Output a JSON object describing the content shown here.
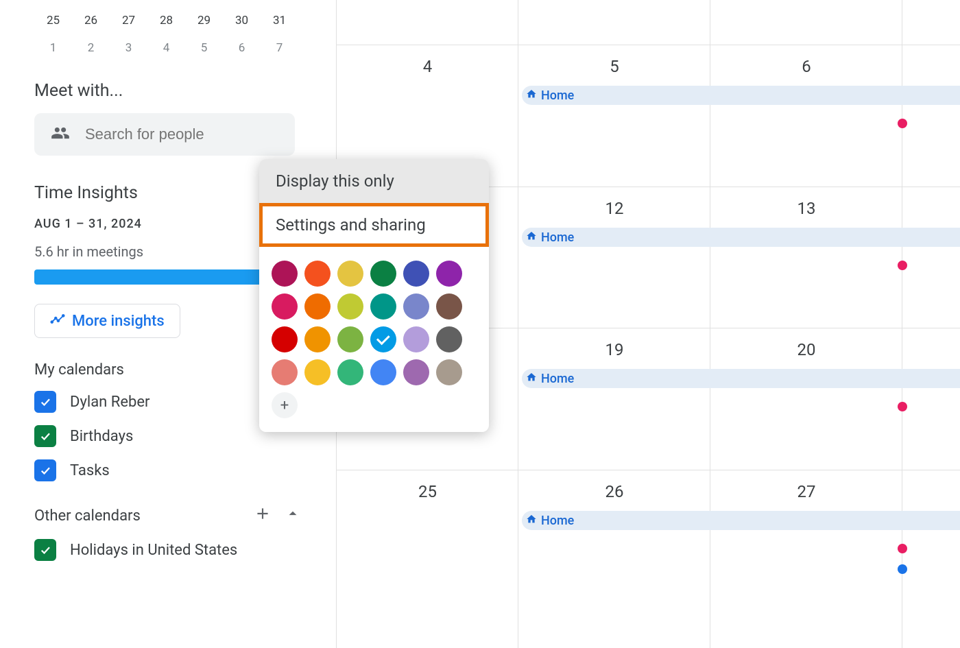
{
  "mini_calendar": {
    "rows": [
      [
        {
          "n": "25"
        },
        {
          "n": "26"
        },
        {
          "n": "27"
        },
        {
          "n": "28"
        },
        {
          "n": "29"
        },
        {
          "n": "30"
        },
        {
          "n": "31"
        }
      ],
      [
        {
          "n": "1",
          "dim": true
        },
        {
          "n": "2",
          "dim": true
        },
        {
          "n": "3",
          "dim": true
        },
        {
          "n": "4",
          "dim": true
        },
        {
          "n": "5",
          "dim": true
        },
        {
          "n": "6",
          "dim": true
        },
        {
          "n": "7",
          "dim": true
        }
      ]
    ]
  },
  "meet_with": {
    "title": "Meet with...",
    "placeholder": "Search for people"
  },
  "time_insights": {
    "title": "Time Insights",
    "range": "AUG 1 – 31, 2024",
    "meeting_hours": "5.6 hr in meetings",
    "more_label": "More insights"
  },
  "my_calendars": {
    "title": "My calendars",
    "items": [
      {
        "label": "Dylan Reber",
        "color": "blue"
      },
      {
        "label": "Birthdays",
        "color": "green"
      },
      {
        "label": "Tasks",
        "color": "blue"
      }
    ]
  },
  "other_calendars": {
    "title": "Other calendars",
    "items": [
      {
        "label": "Holidays in United States",
        "color": "green"
      }
    ]
  },
  "popup": {
    "option1": "Display this only",
    "option2": "Settings and sharing",
    "colors": [
      "#ad1457",
      "#f4511e",
      "#e4c441",
      "#0b8043",
      "#3f51b5",
      "#8e24aa",
      "#d81b60",
      "#ef6c00",
      "#c0ca33",
      "#009688",
      "#7986cb",
      "#795548",
      "#d50000",
      "#f09300",
      "#7cb342",
      "#039be5",
      "#b39ddb",
      "#616161",
      "#e67c73",
      "#f6bf26",
      "#33b679",
      "#4285f4",
      "#9e69af",
      "#a79b8e"
    ],
    "selected_color_index": 15,
    "add_label": "+"
  },
  "calendar_grid": {
    "home_label": "Home",
    "weeks": [
      {
        "days": [
          "4",
          "5",
          "6",
          ""
        ],
        "home_col": 1
      },
      {
        "days": [
          "",
          "12",
          "13",
          ""
        ],
        "home_col": 1
      },
      {
        "days": [
          "",
          "19",
          "20",
          ""
        ],
        "home_col": 1
      },
      {
        "days": [
          "25",
          "26",
          "27",
          ""
        ],
        "home_col": 1
      }
    ]
  }
}
